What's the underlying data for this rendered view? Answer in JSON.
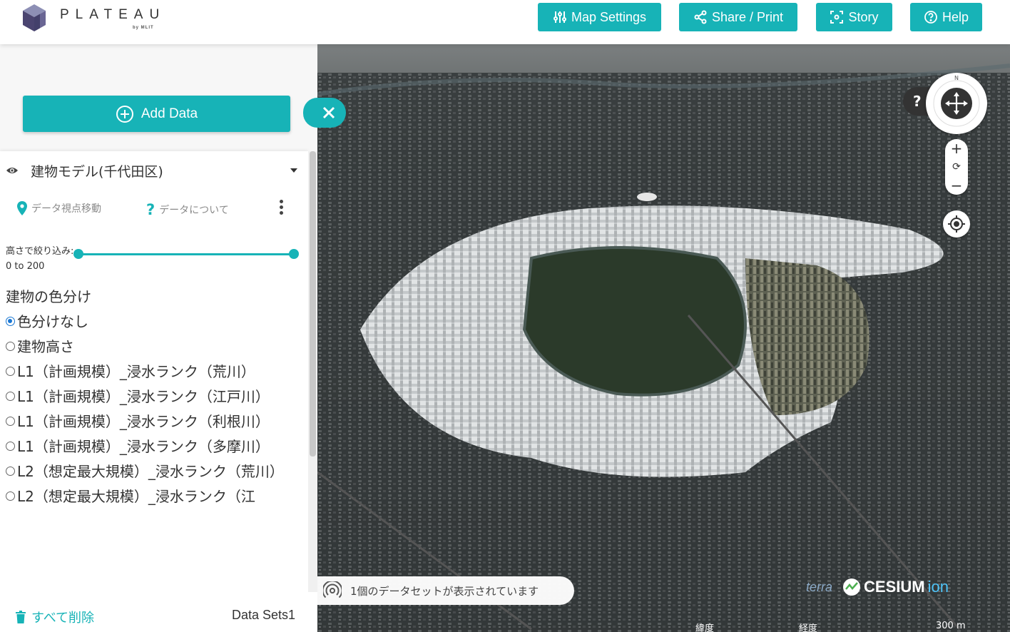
{
  "header": {
    "brand": "PLATEAU",
    "brand_sub": "by MLIT",
    "buttons": [
      {
        "label": "Map Settings",
        "icon": "sliders-icon"
      },
      {
        "label": "Share / Print",
        "icon": "share-icon"
      },
      {
        "label": "Story",
        "icon": "story-icon"
      },
      {
        "label": "Help",
        "icon": "help-icon"
      }
    ]
  },
  "sidebar": {
    "add_data_label": "Add Data",
    "dataset": {
      "title": "建物モデル(千代田区)",
      "actions": {
        "fly_to": "データ視点移動",
        "about": "データについて"
      },
      "height_filter_label": "高さで絞り込み: 0 to 200",
      "height_filter_range": [
        0,
        200
      ],
      "color_heading": "建物の色分け",
      "color_options": [
        {
          "label": "色分けなし",
          "selected": true
        },
        {
          "label": "建物高さ",
          "selected": false
        },
        {
          "label": "L1（計画規模）_浸水ランク（荒川）",
          "selected": false
        },
        {
          "label": "L1（計画規模）_浸水ランク（江戸川）",
          "selected": false
        },
        {
          "label": "L1（計画規模）_浸水ランク（利根川）",
          "selected": false
        },
        {
          "label": "L1（計画規模）_浸水ランク（多摩川）",
          "selected": false
        },
        {
          "label": "L2（想定最大規模）_浸水ランク（荒川）",
          "selected": false
        },
        {
          "label": "L2（想定最大規模）_浸水ランク（江",
          "selected": false
        }
      ]
    },
    "footer": {
      "delete_all": "すべて削除",
      "data_sets": "Data Sets1"
    }
  },
  "map": {
    "help_label": "?",
    "compass_n": "N",
    "zoom_in": "+",
    "zoom_reset": "⟳",
    "zoom_out": "−",
    "notice": "1個のデータセットが表示されています",
    "credit_terra": "terra",
    "credit_cesium": "CESIUM",
    "credit_ion": "ion",
    "scale_lat": "緯度",
    "scale_lon": "経度",
    "scale_dist": "300 m"
  },
  "colors": {
    "accent": "#17b3b7",
    "radio_selected": "#1976d2"
  }
}
